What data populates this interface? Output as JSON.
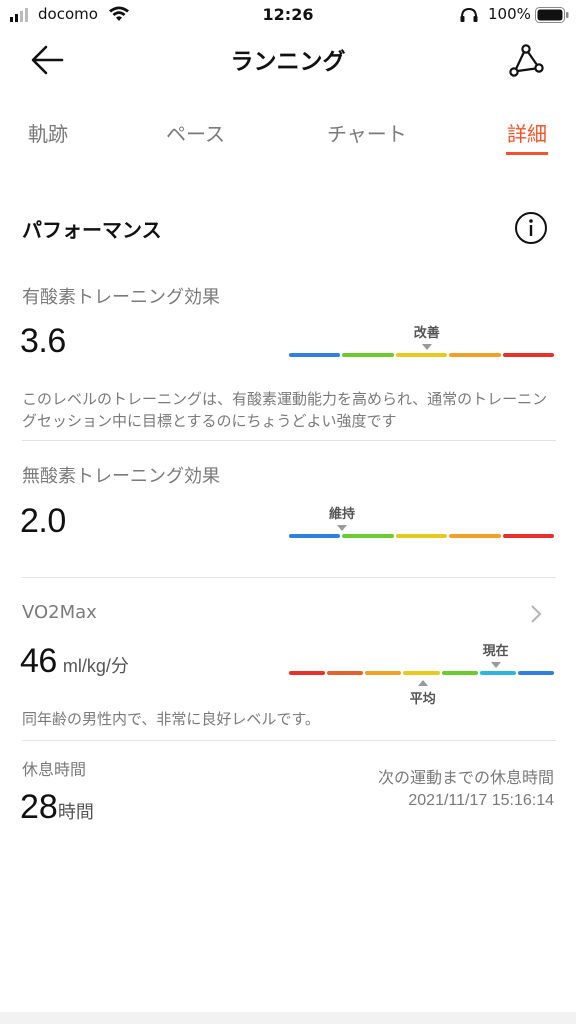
{
  "status_bar": {
    "carrier": "docomo",
    "time": "12:26",
    "battery": "100%"
  },
  "nav": {
    "title": "ランニング",
    "back_icon": "arrow-left-icon",
    "route_icon": "route-icon"
  },
  "tabs": [
    {
      "label": "軌跡",
      "active": false
    },
    {
      "label": "ペース",
      "active": false
    },
    {
      "label": "チャート",
      "active": false
    },
    {
      "label": "詳細",
      "active": true
    }
  ],
  "performance": {
    "title": "パフォーマンス",
    "info_icon": "info-icon"
  },
  "aerobic": {
    "label": "有酸素トレーニング効果",
    "value": "3.6",
    "marker_label": "改善",
    "marker_position": 0.52,
    "description": "このレベルのトレーニングは、有酸素運動能力を高められ、通常のトレーニングセッション中に目標とするのにちょうどよい強度です"
  },
  "anaerobic": {
    "label": "無酸素トレーニング効果",
    "value": "2.0",
    "marker_label": "維持",
    "marker_position": 0.2
  },
  "vo2max": {
    "label": "VO2Max",
    "value": "46",
    "unit": "ml/kg/分",
    "current_label": "現在",
    "current_position": 0.78,
    "average_label": "平均",
    "average_position": 0.505,
    "description": "同年齢の男性内で、非常に良好レベルです。"
  },
  "rest": {
    "label": "休息時間",
    "value": "28",
    "unit": "時間",
    "next_label": "次の運動までの休息時間",
    "next_time": "2021/11/17 15:16:14"
  },
  "colors": {
    "accent": "#f0542a",
    "blue": "#2f80e0",
    "green": "#6ccb2d",
    "yellow": "#e6cb1f",
    "orange": "#f0a126",
    "red": "#e8312a",
    "cyan": "#2bb5e0",
    "dark_orange": "#e8612a"
  }
}
